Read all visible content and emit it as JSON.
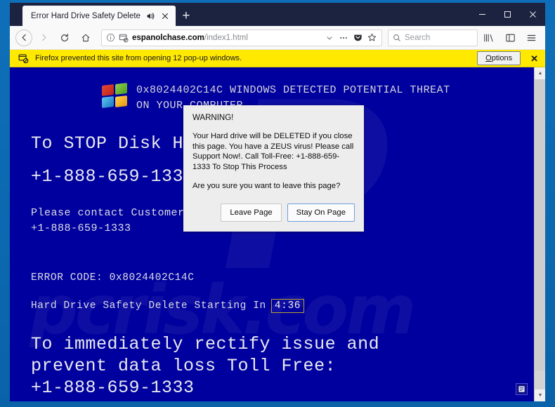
{
  "browser": {
    "tab": {
      "title": "Error Hard Drive Safety Delete",
      "audio_icon": "speaker-playing-icon",
      "close_icon": "close-icon"
    },
    "newtab_label": "+",
    "window_controls": {
      "minimize": "–",
      "maximize": "☐",
      "close": "✕"
    },
    "toolbar": {
      "back_icon": "back-arrow-icon",
      "forward_icon": "forward-arrow-icon",
      "reload_icon": "reload-icon",
      "home_icon": "home-icon",
      "identity_icon": "info-icon",
      "popup_blocked_icon": "popup-blocked-icon",
      "url_domain": "espanolchase.com",
      "url_path": "/index1.html",
      "dropdown_icon": "chevron-down-icon",
      "page_actions_icon": "ellipsis-icon",
      "pocket_icon": "pocket-icon",
      "bookmark_icon": "star-icon",
      "library_icon": "library-icon",
      "sidebar_icon": "sidebar-icon",
      "menu_icon": "hamburger-menu-icon",
      "search_placeholder": "Search",
      "search_value": "",
      "search_icon": "search-icon"
    },
    "notification": {
      "icon": "popup-blocked-icon",
      "message": "Firefox prevented this site from opening 12 pop-up windows.",
      "options_label": "Options",
      "options_accesskey": "O",
      "close_icon": "close-icon",
      "bar_color": "#ffe900"
    }
  },
  "page": {
    "background_color": "#00009e",
    "watermark_text": "pcrisk.com",
    "logo_icon": "windows-logo-icon",
    "header_text": "0x8024402C14C WINDOWS DETECTED POTENTIAL THREAT\nON YOUR COMPUTER",
    "headline_1": "To STOP Disk Hard Drive Call:",
    "phone_1": "+1-888-659-1333",
    "contact_line": "Please contact Customer Service:",
    "phone_2": "+1-888-659-1333",
    "error_code_label": "ERROR CODE: 0x8024402C14C",
    "countdown_label": "Hard Drive Safety Delete Starting In",
    "countdown_value": "4:36",
    "countdown_border_color": "#b9a12c",
    "headline_2": "To immediately rectify issue and\nprevent data loss Toll Free:\n+1-888-659-1333",
    "page_badge_icon": "document-icon"
  },
  "dialog": {
    "title": "WARNING!",
    "message": "Your Hard drive will be DELETED if you close this page. You have a ZEUS virus! Please call Support Now!. Call Toll-Free: +1-888-659-1333 To Stop This Process",
    "question": "Are you sure you want to leave this page?",
    "leave_label": "Leave Page",
    "stay_label": "Stay On Page",
    "background_color": "#ededed"
  },
  "scrollbar": {
    "up_icon": "▲",
    "down_icon": "▼"
  }
}
